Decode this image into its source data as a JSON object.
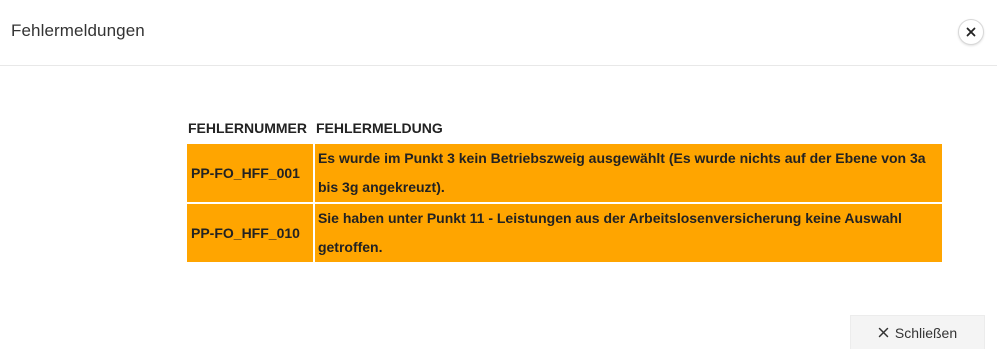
{
  "dialog": {
    "title": "Fehlermeldungen",
    "close_icon": "close-icon"
  },
  "table": {
    "headers": [
      "FEHLERNUMMER",
      "FEHLERMELDUNG"
    ],
    "rows": [
      {
        "code": "PP-FO_HFF_001",
        "message": "Es wurde im Punkt 3 kein Betriebszweig ausgewählt (Es wurde nichts auf der Ebene von 3a bis 3g angekreuzt)."
      },
      {
        "code": "PP-FO_HFF_010",
        "message": "Sie haben unter Punkt 11 - Leistungen aus der Arbeitslosenversicherung keine Auswahl getroffen."
      }
    ],
    "row_color": "#ffa500"
  },
  "footer": {
    "close_label": "Schließen",
    "close_icon": "close-icon"
  }
}
